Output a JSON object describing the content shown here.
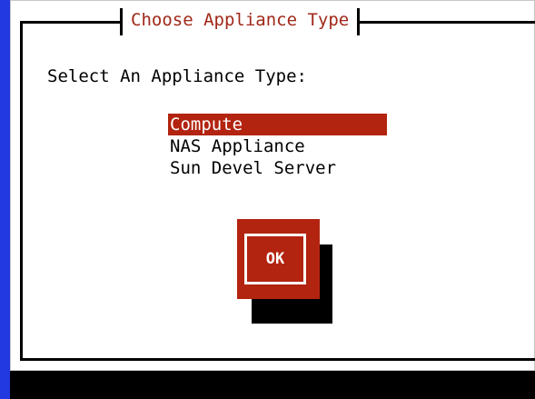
{
  "dialog": {
    "title": "Choose Appliance Type",
    "prompt": "Select An Appliance Type:",
    "options": [
      {
        "label": "Compute",
        "selected": true
      },
      {
        "label": "NAS Appliance",
        "selected": false
      },
      {
        "label": "Sun Devel Server",
        "selected": false
      }
    ],
    "ok_label": "OK"
  },
  "colors": {
    "background": "#1e32d8",
    "accent": "#b22410",
    "title_text": "#a02818"
  }
}
